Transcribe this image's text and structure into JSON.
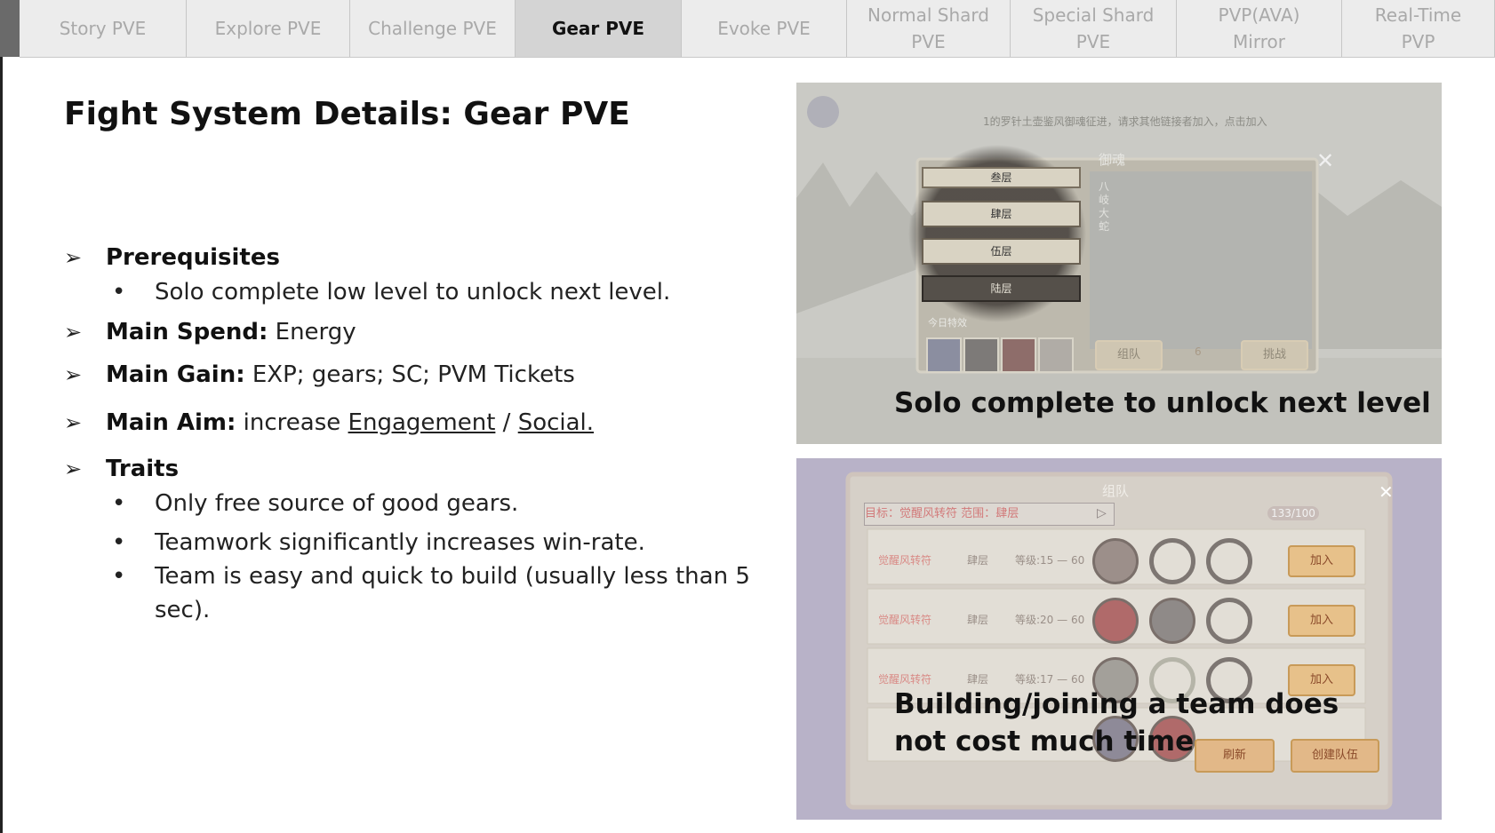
{
  "tabs": [
    {
      "label": "Story PVE",
      "active": false
    },
    {
      "label": "Explore PVE",
      "active": false
    },
    {
      "label": "Challenge PVE",
      "active": false
    },
    {
      "label": "Gear PVE",
      "active": true
    },
    {
      "label": "Evoke PVE",
      "active": false
    },
    {
      "label": "Normal Shard\nPVE",
      "active": false
    },
    {
      "label": "Special Shard\nPVE",
      "active": false
    },
    {
      "label": "PVP(AVA)\nMirror",
      "active": false
    },
    {
      "label": "Real-Time\nPVP",
      "active": false
    }
  ],
  "title": "Fight System Details: Gear PVE",
  "bullets": {
    "prereq": {
      "label": "Prerequisites",
      "sub": "Solo complete low level to unlock next level."
    },
    "spend": {
      "label": "Main Spend:",
      "value": " Energy"
    },
    "gain": {
      "label": "Main Gain:",
      "value": " EXP; gears; SC; PVM Tickets"
    },
    "aim": {
      "label": "Main Aim:",
      "prefix": " increase ",
      "link1": "Engagement",
      "sep": " / ",
      "link2": "Social."
    },
    "traits": {
      "label": "Traits",
      "items": [
        "Only free source of good gears.",
        "Teamwork significantly increases win-rate.",
        "Team is easy and quick to build (usually less than 5 sec)."
      ]
    }
  },
  "images": {
    "top": {
      "caption": "Solo complete to unlock next level",
      "top_banner": "1的罗针土壶鉴风御魂征进，请求其他链接者加入，点击加入",
      "dialog_title": "御魂",
      "floors": [
        "叁层",
        "肆层",
        "伍层",
        "陆层"
      ],
      "boss_name": "八岐大蛇",
      "today_label": "今日特效",
      "team_button": "组队",
      "challenge_button": "挑战",
      "stamina": "6"
    },
    "bottom": {
      "caption": "Building/joining a team does not cost much time",
      "dialog_title": "组队",
      "target_label": "目标：",
      "target_value": "觉醒风转符",
      "range_label": "范围：",
      "range_value": "肆层",
      "stamina_count": "133/100",
      "rows": [
        {
          "name": "觉醒风转符",
          "floor": "肆层",
          "level": "等级:15 — 60",
          "join": "加入"
        },
        {
          "name": "觉醒风转符",
          "floor": "肆层",
          "level": "等级:20 — 60",
          "join": "加入"
        },
        {
          "name": "觉醒风转符",
          "floor": "肆层",
          "level": "等级:17 — 60",
          "join": "加入"
        }
      ],
      "refresh_button": "刷新",
      "create_team_button": "创建队伍"
    }
  }
}
